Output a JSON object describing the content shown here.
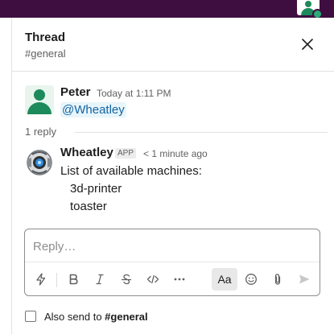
{
  "thread": {
    "title": "Thread",
    "channel": "#general"
  },
  "parent_message": {
    "author": "Peter",
    "timestamp": "Today at 1:11 PM",
    "mention": "@Wheatley"
  },
  "replies": {
    "count_label": "1 reply"
  },
  "reply_message": {
    "author": "Wheatley",
    "badge": "APP",
    "timestamp": "< 1 minute ago",
    "lines": [
      "List of available machines:",
      "3d-printer",
      "toaster"
    ]
  },
  "composer": {
    "placeholder": "Reply…",
    "toolbar": [
      {
        "icon": "lightning-icon"
      },
      {
        "icon": "bold-icon"
      },
      {
        "icon": "italic-icon"
      },
      {
        "icon": "strikethrough-icon"
      },
      {
        "icon": "code-icon"
      },
      {
        "icon": "more-icon"
      },
      {
        "icon": "formatting-icon",
        "label": "Aa"
      },
      {
        "icon": "emoji-icon"
      },
      {
        "icon": "attachment-icon"
      },
      {
        "icon": "send-icon"
      }
    ]
  },
  "also_send": {
    "label": "Also send to",
    "channel": "#general",
    "checked": false
  },
  "colors": {
    "topbar": "#3f0e40",
    "link": "#1264a3",
    "mention_bg": "#e8f5fa",
    "avatar_green": "#1d8a5c",
    "status_green": "#2bac76",
    "muted": "#616061"
  }
}
